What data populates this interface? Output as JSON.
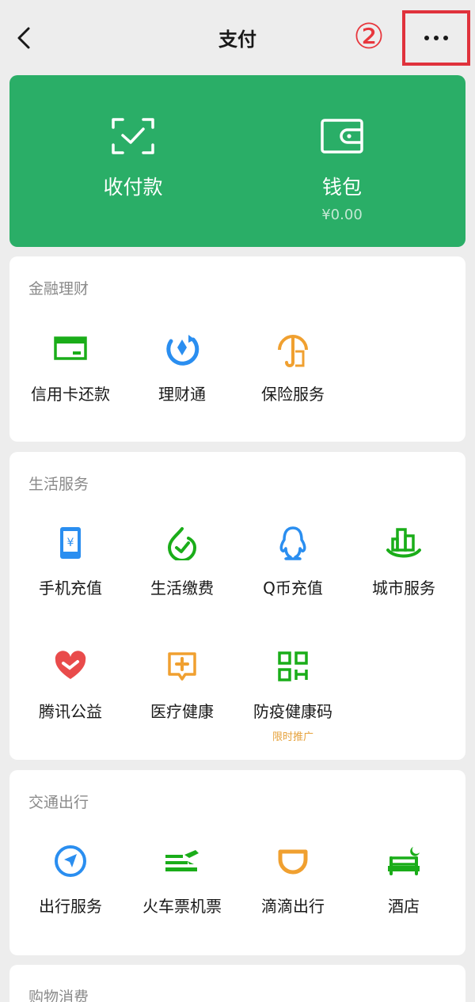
{
  "header": {
    "title": "支付",
    "step_marker": "②"
  },
  "pay_card": {
    "receive": {
      "label": "收付款",
      "icon": "scan-frame-check-icon"
    },
    "wallet": {
      "label": "钱包",
      "balance": "¥0.00",
      "icon": "wallet-icon"
    }
  },
  "sections": {
    "finance": {
      "title": "金融理财",
      "items": [
        {
          "label": "信用卡还款",
          "icon": "credit-card-icon"
        },
        {
          "label": "理财通",
          "icon": "wealth-icon"
        },
        {
          "label": "保险服务",
          "icon": "insurance-umbrella-icon"
        }
      ]
    },
    "life": {
      "title": "生活服务",
      "items": [
        {
          "label": "手机充值",
          "icon": "phone-recharge-icon"
        },
        {
          "label": "生活缴费",
          "icon": "utility-payment-icon"
        },
        {
          "label": "Q币充值",
          "icon": "qq-penguin-icon"
        },
        {
          "label": "城市服务",
          "icon": "city-buildings-icon"
        },
        {
          "label": "腾讯公益",
          "icon": "charity-heart-icon"
        },
        {
          "label": "医疗健康",
          "icon": "medical-cross-icon"
        },
        {
          "label": "防疫健康码",
          "icon": "qr-health-code-icon",
          "promo": "限时推广"
        }
      ]
    },
    "transport": {
      "title": "交通出行",
      "items": [
        {
          "label": "出行服务",
          "icon": "navigation-arrow-icon"
        },
        {
          "label": "火车票机票",
          "icon": "train-plane-icon"
        },
        {
          "label": "滴滴出行",
          "icon": "didi-icon"
        },
        {
          "label": "酒店",
          "icon": "hotel-bed-icon"
        }
      ]
    },
    "shopping": {
      "title": "购物消费"
    }
  },
  "colors": {
    "brand_green": "#2aae67",
    "icon_green": "#1aad19",
    "icon_blue": "#2a8ef0",
    "icon_orange": "#f0a030",
    "icon_red": "#e94b4b",
    "highlight_red": "#e0323c",
    "promo_orange": "#e6a23c"
  }
}
